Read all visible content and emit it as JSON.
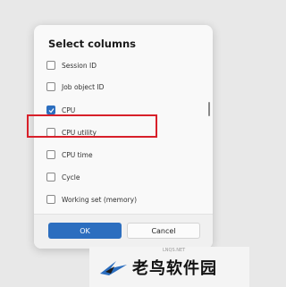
{
  "dialog": {
    "title": "Select columns",
    "items": [
      {
        "label": "Session ID",
        "checked": false
      },
      {
        "label": "Job object ID",
        "checked": false
      },
      {
        "label": "CPU",
        "checked": true
      },
      {
        "label": "CPU utility",
        "checked": false
      },
      {
        "label": "CPU time",
        "checked": false
      },
      {
        "label": "Cycle",
        "checked": false
      },
      {
        "label": "Working set (memory)",
        "checked": false
      }
    ],
    "ok_label": "OK",
    "cancel_label": "Cancel"
  },
  "watermark": {
    "text": "老鸟软件园",
    "sub": "LNQS.NET"
  },
  "colors": {
    "accent": "#2c6ebf",
    "highlight": "#d8202a"
  }
}
